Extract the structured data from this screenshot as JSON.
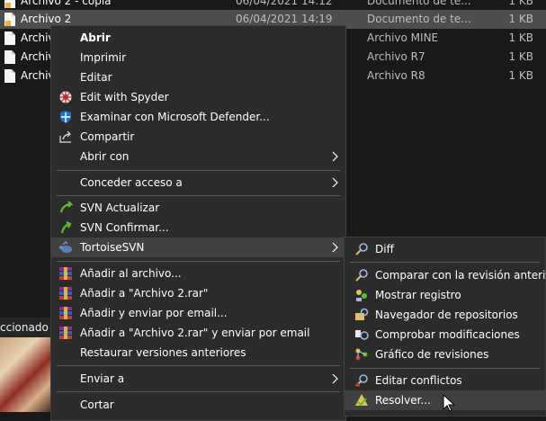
{
  "files": [
    {
      "name": "Archivo 2 - copia",
      "date": "06/04/2021 14:12",
      "type": "Documento de te...",
      "size": "1 KB"
    },
    {
      "name": "Archivo 2",
      "date": "06/04/2021 14:19",
      "type": "Documento de te...",
      "size": "1 KB",
      "selected": true
    },
    {
      "name": "Archivo",
      "date": "",
      "type": "Archivo MINE",
      "size": "1 KB"
    },
    {
      "name": "Archivo",
      "date": "",
      "type": "Archivo R7",
      "size": "1 KB"
    },
    {
      "name": "Archivo",
      "date": "",
      "type": "Archivo R8",
      "size": "1 KB"
    }
  ],
  "status": {
    "selected_text": "ccionado"
  },
  "context_menu": {
    "abrir": "Abrir",
    "imprimir": "Imprimir",
    "editar": "Editar",
    "edit_spyder": "Edit with Spyder",
    "defender": "Examinar con Microsoft Defender...",
    "compartir": "Compartir",
    "abrir_con": "Abrir con",
    "conceder": "Conceder acceso a",
    "svn_actualizar": "SVN Actualizar",
    "svn_confirmar": "SVN Confirmar...",
    "tortoisesvn": "TortoiseSVN",
    "anadir_archivo": "Añadir al archivo...",
    "anadir_rar": "Añadir a \"Archivo 2.rar\"",
    "anadir_email": "Añadir y enviar por email...",
    "anadir_rar_email": "Añadir a \"Archivo 2.rar\" y enviar por email",
    "restaurar": "Restaurar versiones anteriores",
    "enviar_a": "Enviar a",
    "cortar": "Cortar"
  },
  "tortoise_submenu": {
    "diff": "Diff",
    "comparar": "Comparar con la revisión anterior",
    "mostrar_registro": "Mostrar registro",
    "navegador": "Navegador de repositorios",
    "comprobar": "Comprobar modificaciones",
    "grafico": "Gráfico de revisiones",
    "editar_conflictos": "Editar conflictos",
    "resolver": "Resolver..."
  },
  "colors": {
    "background": "#191919",
    "menu_bg": "#2b2b2b",
    "highlight": "#414141",
    "svn_green": "#5cbf2a",
    "defender_blue": "#1e73c8"
  },
  "icons": {
    "file": "text-file-icon",
    "spyder": "spyder-icon",
    "defender": "shield-icon",
    "share": "share-icon",
    "svn_update": "svn-update-icon",
    "svn_commit": "svn-commit-icon",
    "tortoise": "tortoise-icon",
    "rar": "winrar-icon",
    "submenu": "chevron-right-icon"
  }
}
